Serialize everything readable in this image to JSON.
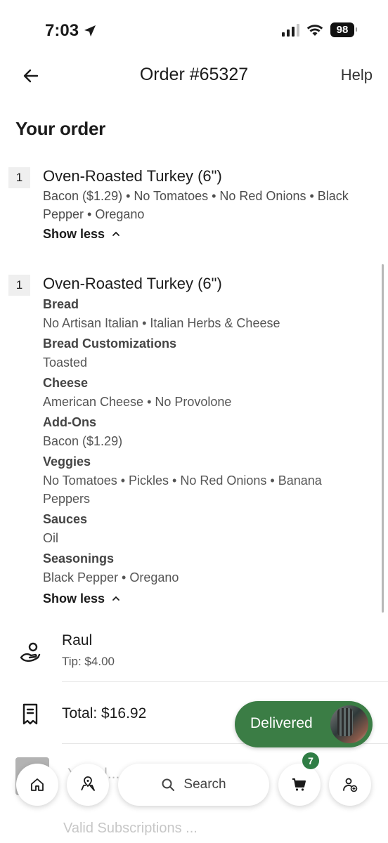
{
  "status_bar": {
    "time": "7:03",
    "battery": "98"
  },
  "header": {
    "title": "Order #65327",
    "help_label": "Help"
  },
  "section_title": "Your order",
  "items": [
    {
      "qty": "1",
      "name": "Oven-Roasted Turkey (6\")",
      "summary": "Bacon ($1.29) • No Tomatoes • No Red Onions • Black Pepper • Oregano",
      "toggle_label": "Show less"
    },
    {
      "qty": "1",
      "name": "Oven-Roasted Turkey (6\")",
      "groups": [
        {
          "heading": "Bread",
          "value": "No Artisan Italian • Italian Herbs & Cheese"
        },
        {
          "heading": "Bread Customizations",
          "value": "Toasted"
        },
        {
          "heading": "Cheese",
          "value": "American Cheese • No Provolone"
        },
        {
          "heading": "Add-Ons",
          "value": "Bacon ($1.29)"
        },
        {
          "heading": "Veggies",
          "value": "No Tomatoes • Pickles • No Red Onions • Banana Peppers"
        },
        {
          "heading": "Sauces",
          "value": "Oil"
        },
        {
          "heading": "Seasonings",
          "value": "Black Pepper • Oregano"
        }
      ],
      "toggle_label": "Show less"
    }
  ],
  "courier": {
    "name": "Raul",
    "tip": "Tip: $4.00",
    "icon": "courier-hand-icon"
  },
  "total": {
    "label": "Total: $16.92",
    "icon": "receipt-icon"
  },
  "delivered": {
    "label": "Delivered"
  },
  "peek": {
    "line1": "Y...del...",
    "line2": "Valid Subscriptions ..."
  },
  "bottom_nav": {
    "search_label": "Search",
    "cart_count": "7",
    "icons": [
      "home-icon",
      "location-pin-icon",
      "search-icon",
      "cart-icon",
      "account-icon"
    ]
  },
  "colors": {
    "accent_green": "#3b7d45",
    "badge_green": "#2f7d45",
    "text": "#1b1b1b"
  }
}
